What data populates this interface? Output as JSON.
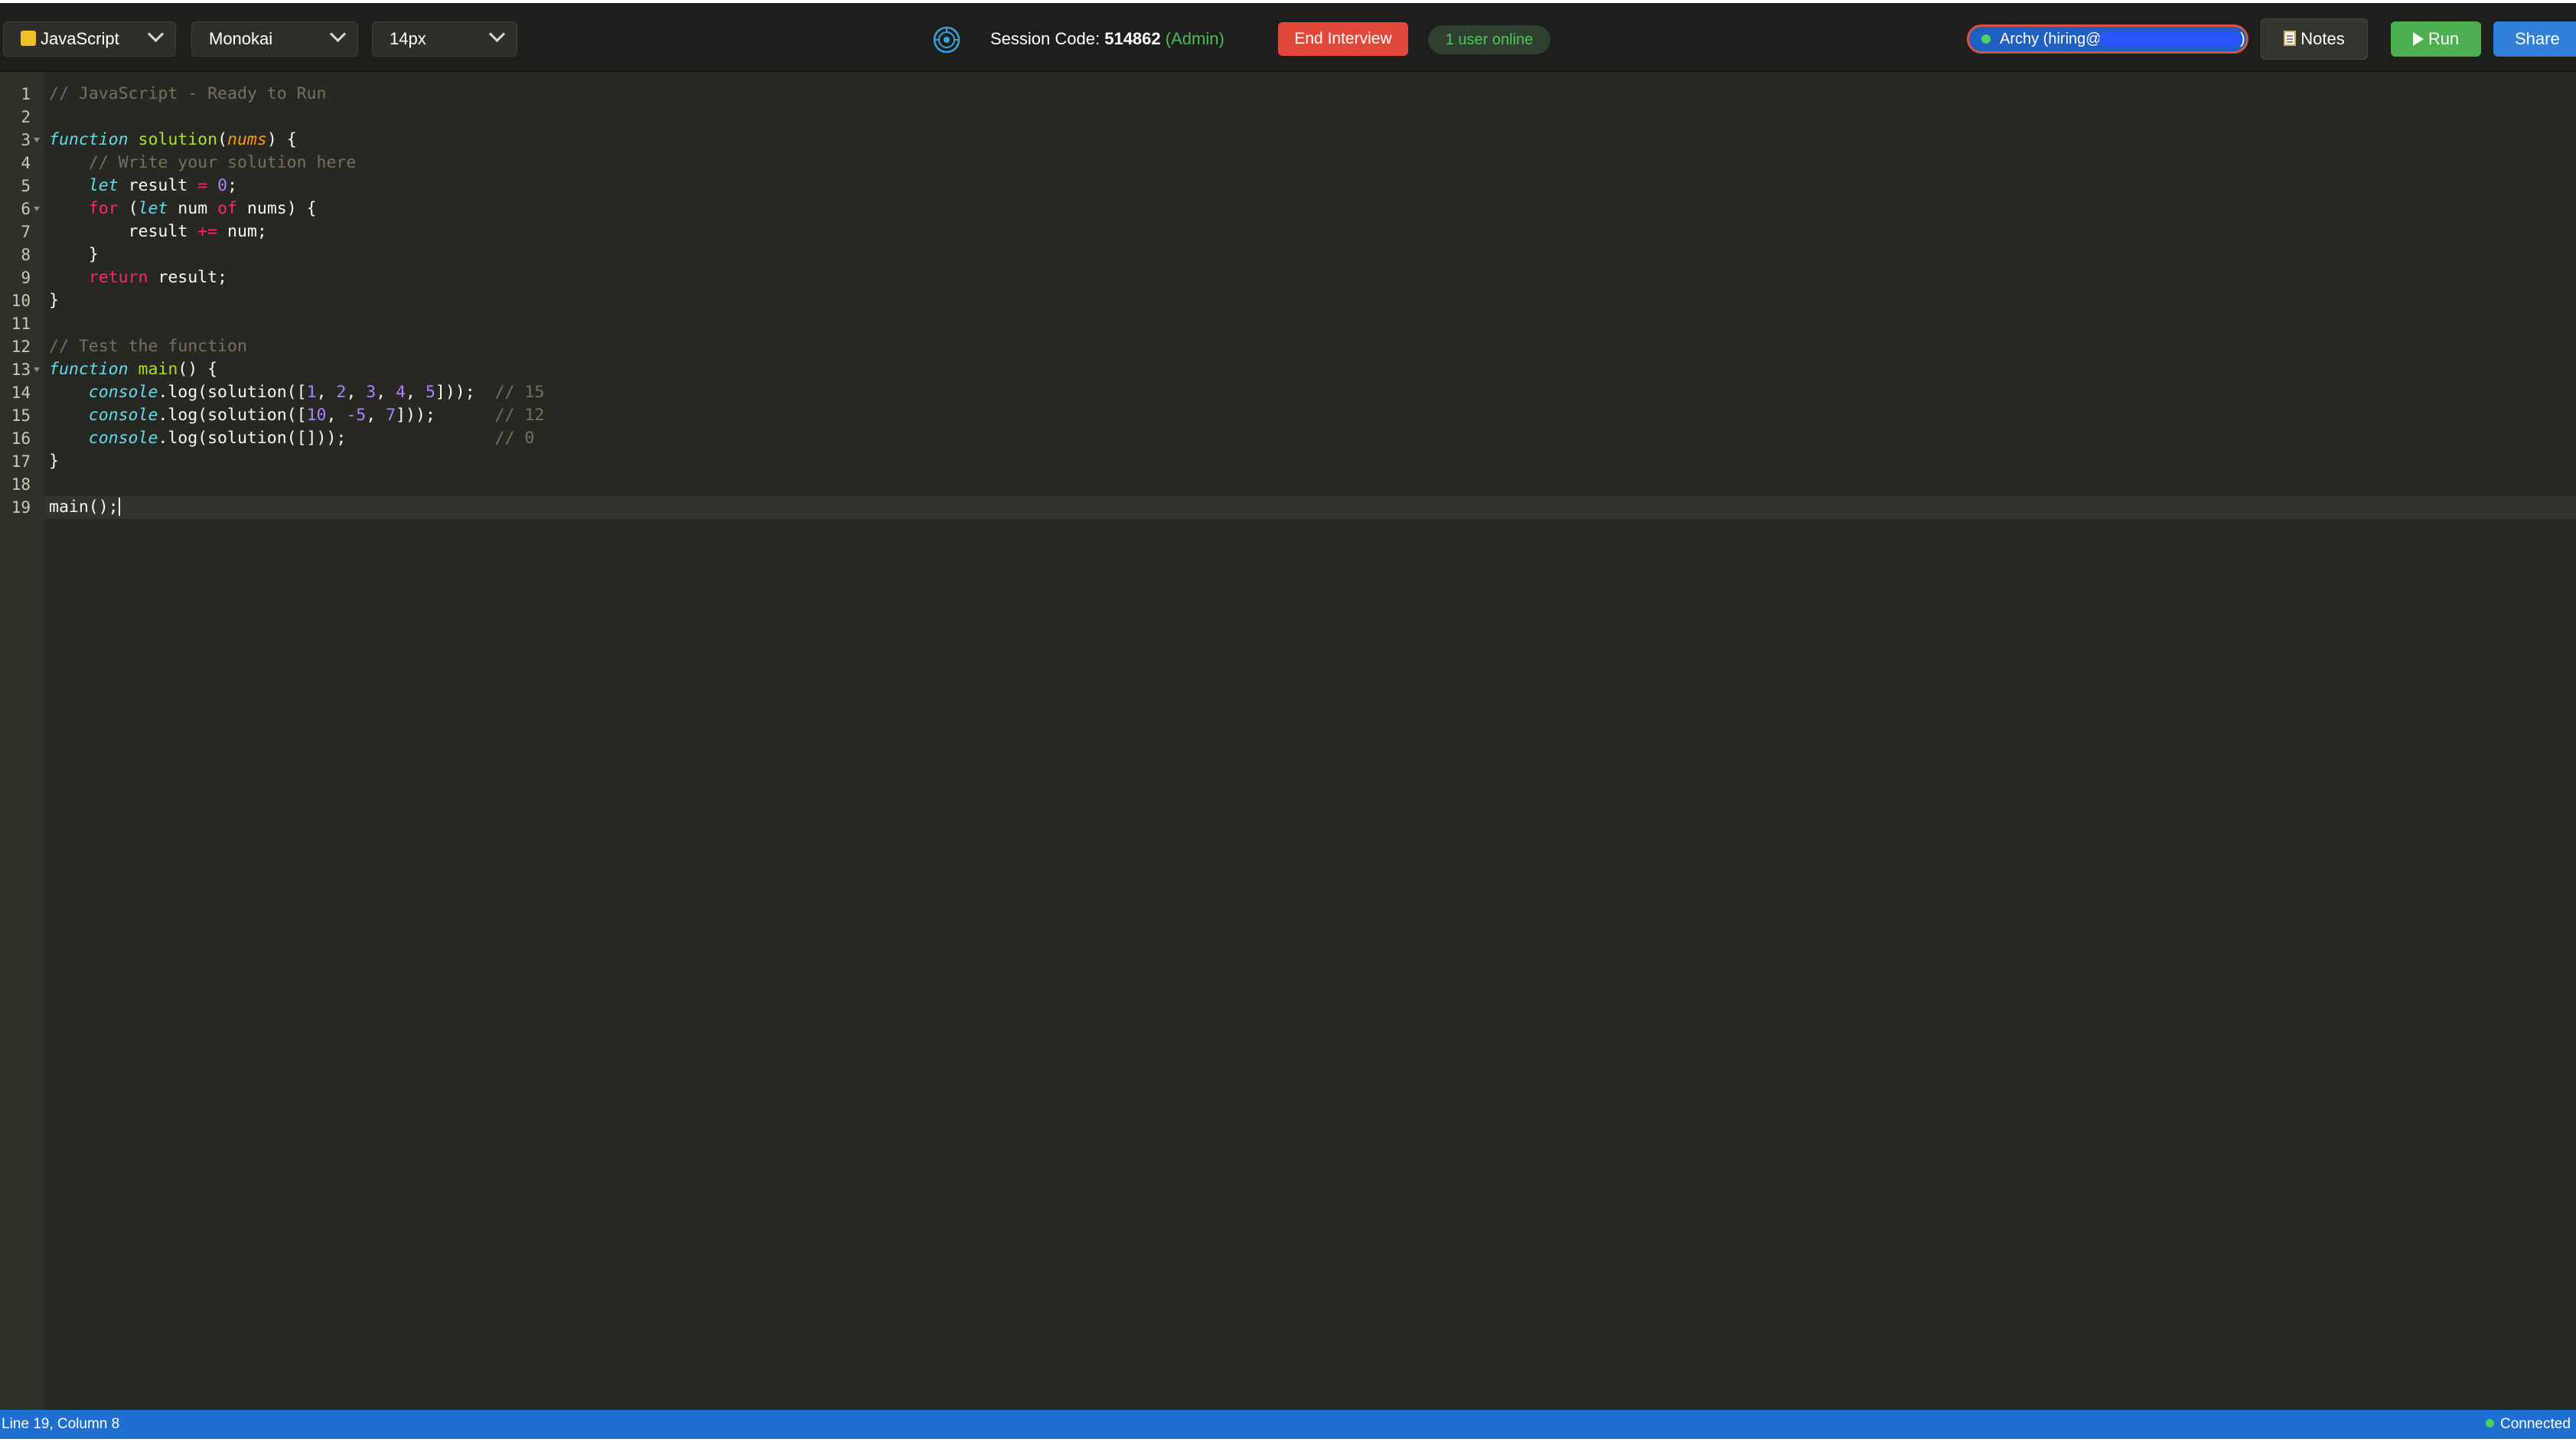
{
  "toolbar": {
    "language": {
      "selected": "JavaScript",
      "icon": "javascript-square-icon",
      "color": "#f0c02a"
    },
    "theme": {
      "selected": "Monokai"
    },
    "font_size": {
      "selected": "14px"
    },
    "session": {
      "label": "Session Code:",
      "code": "514862",
      "role": "(Admin)"
    },
    "end_interview_label": "End Interview",
    "online_label": "1 user online",
    "user_label": "Archy (hiring@",
    "user_label_tail": ")",
    "notes_label": "Notes",
    "run_label": "Run",
    "share_label": "Share"
  },
  "editor": {
    "active_line": 19,
    "lines": [
      "// JavaScript - Ready to Run",
      "",
      "function solution(nums) {",
      "    // Write your solution here",
      "    let result = 0;",
      "    for (let num of nums) {",
      "        result += num;",
      "    }",
      "    return result;",
      "}",
      "",
      "// Test the function",
      "function main() {",
      "    console.log(solution([1, 2, 3, 4, 5]));  // 15",
      "    console.log(solution([10, -5, 7]));      // 12",
      "    console.log(solution([]));               // 0",
      "}",
      "",
      "main();"
    ],
    "fold_lines": [
      3,
      6,
      13
    ]
  },
  "statusbar": {
    "position": "Line 19, Column 8",
    "connection": "Connected"
  },
  "colors": {
    "editor_bg": "#272822",
    "run_button": "#4caf50",
    "end_button": "#e0493a",
    "share_button": "#2f80d6",
    "statusbar": "#1f6fd1"
  }
}
